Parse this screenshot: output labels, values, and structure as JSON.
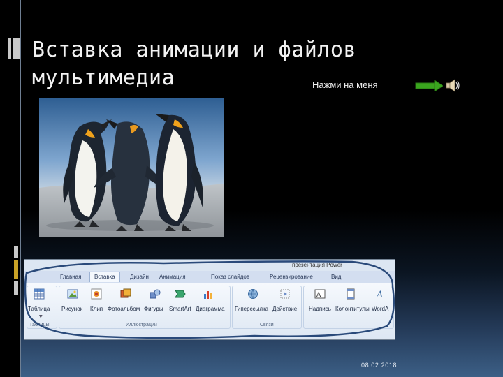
{
  "slide": {
    "title_line1": "Вставка анимации и файлов",
    "title_line2": "мультимедиа",
    "action_text": "Нажми на меня",
    "arrow_icon": "green-arrow-icon",
    "sound_icon": "speaker-icon",
    "date": "08.02.2018",
    "photo_description": "penguins"
  },
  "ribbon": {
    "window_title": "презентация Power",
    "tabs": [
      {
        "label": "Главная"
      },
      {
        "label": "Вставка"
      },
      {
        "label": "Дизайн"
      },
      {
        "label": "Анимация"
      },
      {
        "label": "Показ слайдов"
      },
      {
        "label": "Рецензирование"
      },
      {
        "label": "Вид"
      }
    ],
    "commands": [
      {
        "label": "Таблица",
        "icon": "table-icon"
      },
      {
        "label": "Рисунок",
        "icon": "picture-icon"
      },
      {
        "label": "Клип",
        "icon": "clipart-icon"
      },
      {
        "label": "Фотоальбом",
        "icon": "photo-album-icon"
      },
      {
        "label": "Фигуры",
        "icon": "shapes-icon"
      },
      {
        "label": "SmartArt",
        "icon": "smartart-icon"
      },
      {
        "label": "Диаграмма",
        "icon": "chart-icon"
      },
      {
        "label": "Гиперссылка",
        "icon": "hyperlink-icon"
      },
      {
        "label": "Действие",
        "icon": "action-icon"
      },
      {
        "label": "Надпись",
        "icon": "textbox-icon"
      },
      {
        "label": "Колонтитулы",
        "icon": "header-footer-icon"
      },
      {
        "label": "WordA",
        "icon": "wordart-icon"
      }
    ],
    "groups": [
      {
        "label": "Таблицы"
      },
      {
        "label": "Иллюстрации"
      },
      {
        "label": "Связи"
      }
    ]
  },
  "colors": {
    "background": "#000000",
    "accent_border": "#6f7f93",
    "arrow": "#3aa51e",
    "title_text": "#f2f2f2"
  }
}
